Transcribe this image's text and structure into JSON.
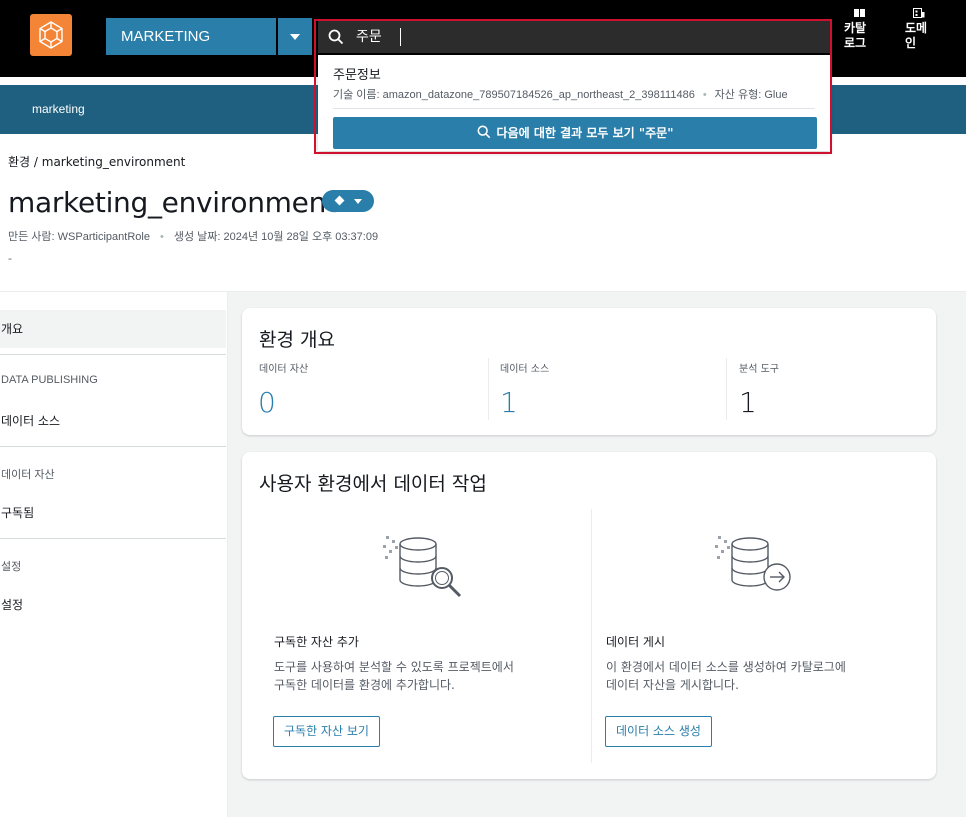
{
  "header": {
    "domain_selector": "MARKETING",
    "search_value": "주문",
    "catalog_label_1": "카탈",
    "catalog_label_2": "로그",
    "domain_label_1": "도메",
    "domain_label_2": "인"
  },
  "search_suggestion": {
    "title": "주문정보",
    "technical_name": "기술 이름: amazon_datazone_789507184526_ap_northeast_2_398111486",
    "asset_type": "자산 유형: Glue",
    "see_all_label": "다음에 대한 결과 모두 보기 \"주문\""
  },
  "subnav": {
    "project": "marketing"
  },
  "breadcrumb": {
    "root": "환경",
    "separator": " / ",
    "current": "marketing_environment"
  },
  "page": {
    "title": "marketing_environment",
    "created_by": "만든 사람: WSParticipantRole",
    "created_at": "생성 날짜: 2024년 10월 28일 오후 03:37:09",
    "description": "-"
  },
  "sidebar": {
    "overview": "개요",
    "section_publishing": "DATA PUBLISHING",
    "data_sources": "데이터 소스",
    "section_assets": "데이터 자산",
    "subscribed": "구독됨",
    "section_settings": "설정",
    "settings": "설정"
  },
  "overview_card": {
    "title": "환경 개요",
    "stats": [
      {
        "label": "데이터 자산",
        "value": "0"
      },
      {
        "label": "데이터 소스",
        "value": "1"
      },
      {
        "label": "분석 도구",
        "value": "1"
      }
    ]
  },
  "work_card": {
    "title": "사용자 환경에서 데이터 작업",
    "left": {
      "title": "구독한 자산 추가",
      "desc_1": "도구를 사용하여 분석할 수 있도록 프로젝트에서",
      "desc_2": "구독한 데이터를 환경에 추가합니다.",
      "button": "구독한 자산 보기"
    },
    "right": {
      "title": "데이터 게시",
      "desc_1": "이 환경에서 데이터 소스를 생성하여 카탈로그에",
      "desc_2": "데이터 자산을 게시합니다.",
      "button": "데이터 소스 생성"
    }
  },
  "colors": {
    "primary": "#2a7eaa",
    "logo": "#f58536",
    "subnav": "#1f5f7f",
    "highlight": "#d0102f",
    "stat_accent": "#2a7eaa"
  },
  "icons": [
    "app-logo-icon",
    "chevron-down-icon",
    "search-icon",
    "catalog-icon",
    "domain-icon",
    "database-search-icon",
    "database-publish-icon"
  ]
}
